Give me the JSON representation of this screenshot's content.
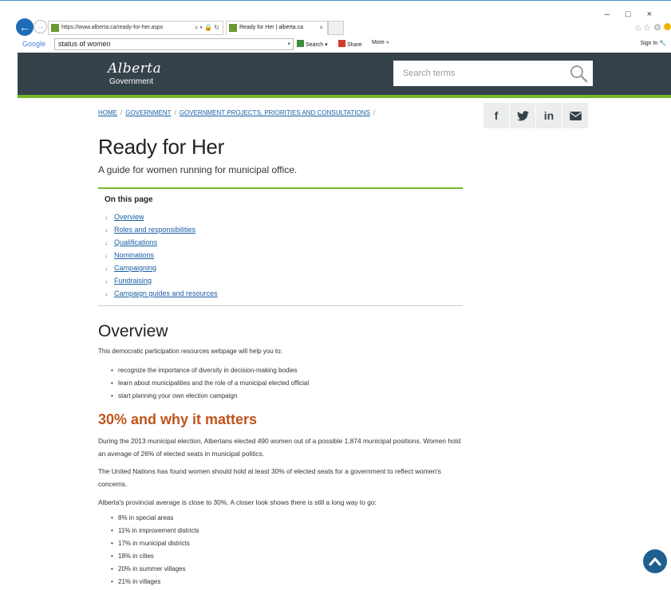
{
  "browser": {
    "url": "https://www.alberta.ca/ready-for-her.aspx",
    "tab_title": "Ready for Her | alberta.ca",
    "toolbar": {
      "google_label": "Google",
      "search_value": "status of women",
      "search_btn": "Search",
      "share_btn": "Share",
      "more_btn": "More »",
      "signin": "Sign In"
    }
  },
  "header": {
    "logo_line1": "Alberta",
    "logo_line2": "Government",
    "search_placeholder": "Search terms"
  },
  "breadcrumb": [
    "HOME",
    "GOVERNMENT",
    "GOVERNMENT PROJECTS, PRIORITIES AND CONSULTATIONS"
  ],
  "social": [
    "f",
    "t",
    "in",
    "m"
  ],
  "page": {
    "title": "Ready for Her",
    "subtitle": "A guide for women running for municipal office.",
    "on_this_page_title": "On this page",
    "on_this_page": [
      "Overview",
      "Roles and responsibilities",
      "Qualifications",
      "Nominations",
      "Campaigning",
      "Fundraising",
      "Campaign guides and resources"
    ],
    "overview_heading": "Overview",
    "overview_intro": "This democratic participation resources webpage will help you to:",
    "overview_bullets": [
      "recognize the importance of diversity in decision-making bodies",
      "learn about municipalities and the role of a municipal elected official",
      "start planning your own election campaign"
    ],
    "matters_heading": "30% and why it matters",
    "para1": "During the 2013 municipal election, Albertans elected 490 women out of a possible 1,874 municipal positions. Women hold an average of 26% of elected seats in municipal politics.",
    "para2": "The United Nations has found women should hold at least 30% of elected seats for a government to reflect women's concerns.",
    "para3": "Alberta's provincial average is close to 30%. A closer look shows there is still a long way to go:",
    "stats": [
      "8% in special areas",
      "11% in improvement districts",
      "17% in municipal districts",
      "18% in cities",
      "20% in summer villages",
      "21% in villages"
    ]
  },
  "colors": {
    "header_bg": "#36424a",
    "accent_green": "#77b82a",
    "link": "#1a5fa6",
    "orange_heading": "#c1541c"
  }
}
